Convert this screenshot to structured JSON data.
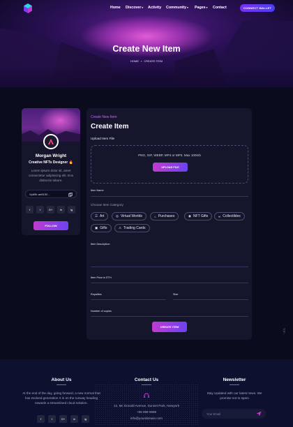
{
  "nav": {
    "items": [
      {
        "label": "Home",
        "caret": ""
      },
      {
        "label": "Discover",
        "caret": "▾"
      },
      {
        "label": "Activity",
        "caret": ""
      },
      {
        "label": "Community",
        "caret": "▾"
      },
      {
        "label": "Pages",
        "caret": "▾"
      },
      {
        "label": "Contact",
        "caret": ""
      }
    ],
    "wallet_button": "CONNECT WALLET"
  },
  "hero": {
    "title": "Create New Item",
    "breadcrumb": {
      "home": "HOME",
      "separator": "•",
      "current": "CREATE ITEM"
    }
  },
  "profile": {
    "name": "Morgan Wright",
    "role": "Creative NFTs Designer 🔥",
    "bio": "Lorem ipsum dolor sit, amet consectetur adipisicing elit. Eos distinctio labore.",
    "wallet_address": "Xp6l5r-ae8152...",
    "socials": [
      "f",
      "t",
      "G+",
      "in",
      "ig"
    ],
    "follow_button": "FOLLOW"
  },
  "form": {
    "subtitle": "Create New Item",
    "title": "Create Item",
    "upload_label": "Upload Item File",
    "upload_types": "PNG, GIF, WEBP, MP4 or MP3. Max 100mb",
    "upload_button": "UPLOAD FILE",
    "item_name_label": "Item Name",
    "category_label": "Choose Item Category",
    "categories": [
      {
        "label": "Art",
        "icon": "art-icon"
      },
      {
        "label": "Virtual Worlds",
        "icon": "globe-icon"
      },
      {
        "label": "Purchases",
        "icon": "bag-icon"
      },
      {
        "label": "NFT Gifts",
        "icon": "gift-token-icon"
      },
      {
        "label": "Collectibles",
        "icon": "link-icon"
      },
      {
        "label": "Gifts",
        "icon": "gift-icon"
      },
      {
        "label": "Trading Cards",
        "icon": "card-icon"
      }
    ],
    "description_label": "Item Description",
    "price_label": "Item Price in ETH",
    "royalties_label": "Royalties",
    "size_label": "Size",
    "copies_label": "Number of copies",
    "create_button": "CREATE ITEM"
  },
  "side_tag": "TOP ↑",
  "footer": {
    "about": {
      "title": "About Us",
      "text": "At the end of the day, going forward, a new normal that has evolved generation X is on the runway heading towards a streamlined cloud solution.",
      "socials": [
        "f",
        "t",
        "G+",
        "in",
        "ig"
      ]
    },
    "contact": {
      "title": "Contact Us",
      "address": "12, Mc Donald Avenue, Sunset Park, Newyork",
      "phone": "+99 999 9999",
      "email": "info@yourdomain.com"
    },
    "newsletter": {
      "title": "Newsletter",
      "text": "Stay Updated with our latest news. We promise not to spam",
      "placeholder": "Your Email"
    }
  },
  "colors": {
    "accent": "#c13bd1",
    "accent2": "#6d42f0",
    "background": "#0b0b1e",
    "card": "#15162c"
  }
}
